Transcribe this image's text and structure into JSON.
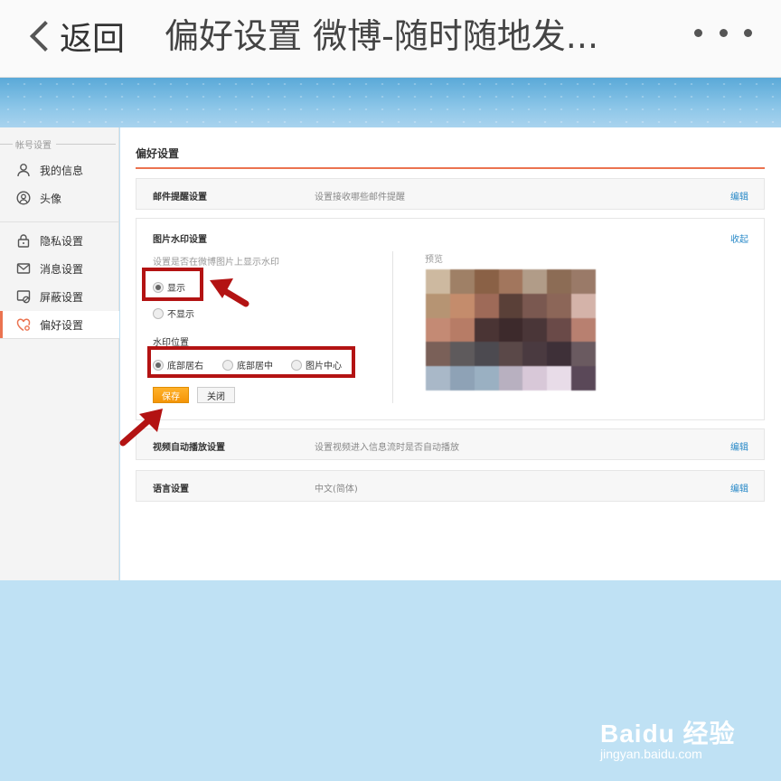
{
  "topbar": {
    "back_label": "返回",
    "title": "偏好设置 微博-随时随地发..."
  },
  "sidebar": {
    "group_label": "帐号设置",
    "items": [
      {
        "label": "我的信息",
        "icon": "user-icon"
      },
      {
        "label": "头像",
        "icon": "avatar-icon"
      },
      {
        "label": "隐私设置",
        "icon": "lock-icon"
      },
      {
        "label": "消息设置",
        "icon": "mail-icon"
      },
      {
        "label": "屏蔽设置",
        "icon": "block-icon"
      },
      {
        "label": "偏好设置",
        "icon": "heart-gear-icon",
        "active": true
      }
    ]
  },
  "main": {
    "title": "偏好设置",
    "rows": {
      "email": {
        "label": "邮件提醒设置",
        "desc": "设置接收哪些邮件提醒",
        "action": "编辑"
      },
      "video": {
        "label": "视频自动播放设置",
        "desc": "设置视频进入信息流时是否自动播放",
        "action": "编辑"
      },
      "language": {
        "label": "语言设置",
        "desc": "中文(简体)",
        "action": "编辑"
      }
    },
    "watermark": {
      "title": "图片水印设置",
      "collapse": "收起",
      "desc": "设置是否在微博图片上显示水印",
      "show_label": "显示",
      "hide_label": "不显示",
      "show_selected": true,
      "position_label": "水印位置",
      "positions": [
        "底部居右",
        "底部居中",
        "图片中心"
      ],
      "position_selected": "底部居右",
      "save_label": "保存",
      "close_label": "关闭",
      "preview_label": "预览"
    }
  },
  "watermark_logo": {
    "text": "Baidu 经验",
    "url_text": "jingyan.baidu.com"
  },
  "colors": {
    "accent": "#eb7350",
    "link": "#2a8ac8",
    "save": "#f49507",
    "annotation": "#b31313"
  }
}
